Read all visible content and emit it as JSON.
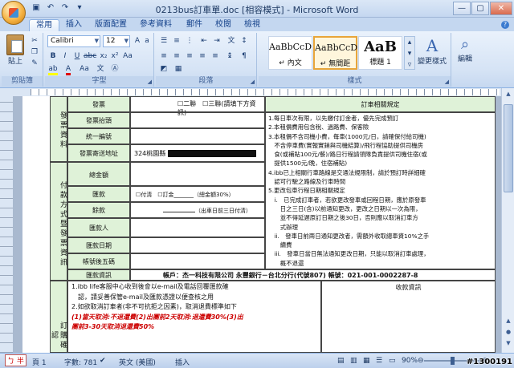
{
  "window": {
    "title": "0213bus訂車單.doc [相容模式] - Microsoft Word",
    "qat_icons": [
      "save-icon",
      "undo-icon",
      "redo-icon",
      "customize-icon"
    ]
  },
  "tabs": [
    "常用",
    "插入",
    "版面配置",
    "參考資料",
    "郵件",
    "校閱",
    "檢視"
  ],
  "ribbon": {
    "clipboard": {
      "paste_label": "貼上",
      "group_label": "剪貼簿"
    },
    "font": {
      "font_name": "Calibri",
      "font_size": "12",
      "group_label": "字型"
    },
    "paragraph": {
      "group_label": "段落"
    },
    "styles": {
      "tiles": [
        {
          "sample": "AaBbCcD",
          "name": "↵ 內文"
        },
        {
          "sample": "AaBbCcD",
          "name": "↵ 無間距"
        },
        {
          "sample": "AaB",
          "name": "標題 1"
        }
      ],
      "change_styles_label": "變更樣式",
      "group_label": "樣式"
    },
    "editing": {
      "label": "編輯"
    }
  },
  "form": {
    "left_header_1": "發票資料",
    "left_header_2": "付款方式暨發票資訊",
    "left_header_3": "訂購確認",
    "rows": {
      "invoice": "發票",
      "invoice_opt": "☐二聯　☐三聯(請填下方資訊)",
      "invoice_title": "發票抬頭",
      "tax_id": "統一編號",
      "invoice_address": "發票寄送地址",
      "address_value": "324桃園縣",
      "total": "總金額",
      "remit": "匯款",
      "remit_opt": "☐付清　☐訂金_______（總金額30%）",
      "balance": "餘款",
      "balance_note": "（出車日前三日付清）",
      "remitter": "匯款人",
      "remit_date": "匯款日期",
      "account_last5": "帳號後五碼",
      "remit_info": "匯款資訊",
      "remit_info_value": "帳戶：杰一科技有限公司 永豐銀行－台北分行(代號807) 帳號：021-001-0002287-8"
    },
    "rules": {
      "title": "訂車相關規定",
      "items": [
        "1.每日車次有限，以先繳付訂金者，優先完成預訂",
        "2.本租價費用包含稅、過路費、保客險",
        "3.本租價不含司機小費，每車(1000元/日，請確保付給司機)",
        "　不含停車費(實報實銷與司機結算)/飛行程協助提供司機房",
        "　食(或補貼100元/餐)/路日行程請領隊負責提供司機住宿(或",
        "　提供1500元/晚，住宿補貼)",
        "4.ibb已上相關行車路線是交通法規限制，請於預訂時詳細確",
        "　認可行駛之路線及行車時間",
        "5.更改包車行程日期相關規定",
        "　i.　已完成訂車者，若欲更改發車或回程日期，應於原發車",
        "　　日之三日(含)以前通知更改，更改之日期以一次為限，",
        "　　並不得延遲原訂日期之後30日，否則應以取消訂車方",
        "　　式辦理",
        "　ii.　發車日前兩日通知更改者，需額外收取總車資10%之手",
        "　　續費",
        "　iii.　發車日當日無法通知更改日期，只能以取消訂車處理，",
        "　　概不退還"
      ]
    },
    "confirm": {
      "line1": "1.ibb life客服中心收到後會以e-mail及電話回覆匯款確",
      "line2": "　認，請妥善保管e-mail及匯款憑證以便查核之用",
      "line3": "2.如欲取消訂車者(非不可抗拒之因素)，取消退費標準如下",
      "line4": "(1)當天取消:不退還費(2)出團前2天取消:退還費30%(3)出",
      "line5": "團前3-30天取消退還費50%",
      "receipt_label": "收款資訊"
    },
    "highlight_color": "#cc0000"
  },
  "statusbar": {
    "page": "頁 1",
    "words": "字數: 781",
    "language": "英文 (美國)",
    "mode": "插入",
    "zoom": "90%"
  },
  "watermark": "#1300191"
}
